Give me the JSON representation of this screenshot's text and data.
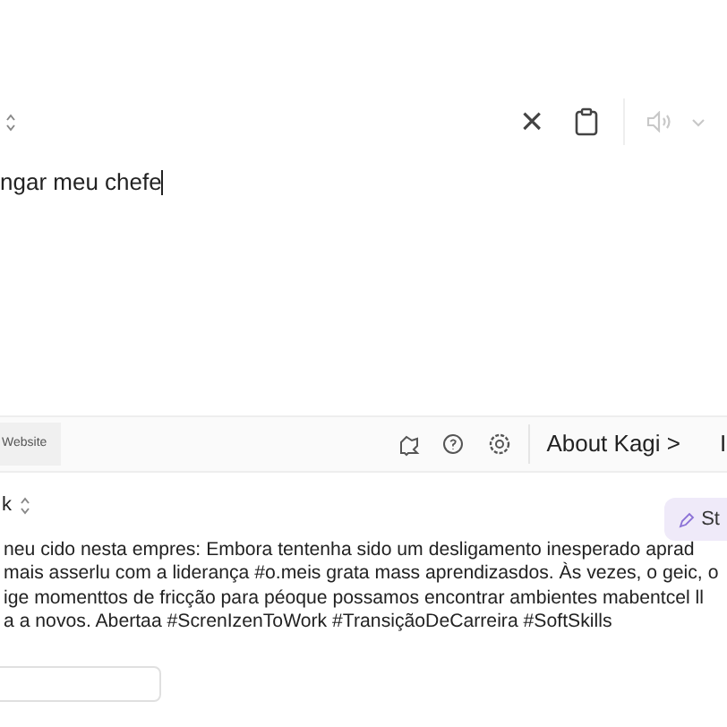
{
  "input_panel": {
    "toolbar": {
      "clear_label": "×",
      "speak_disabled": true
    },
    "text": "ngar meu chefe"
  },
  "footer_bar": {
    "tag": "Website",
    "link": "About Kagi",
    "link_arrow": ">",
    "cut_item": "I"
  },
  "output_panel": {
    "language": "k",
    "action_button": "St",
    "lines": [
      "neu cido nesta empres: Embora tentenha sido um desligamento inesperado aprad",
      "mais asserlu com a liderança #o.meis grata mass aprendizasdos. Às vezes, o geic, o",
      "ige momenttos de fricção para péoque possamos encontrar ambientes mabentcel ll",
      "a a novos. Abertaa #ScrenIzenToWork #TransiçãoDeCarreira #SoftSkills"
    ]
  }
}
